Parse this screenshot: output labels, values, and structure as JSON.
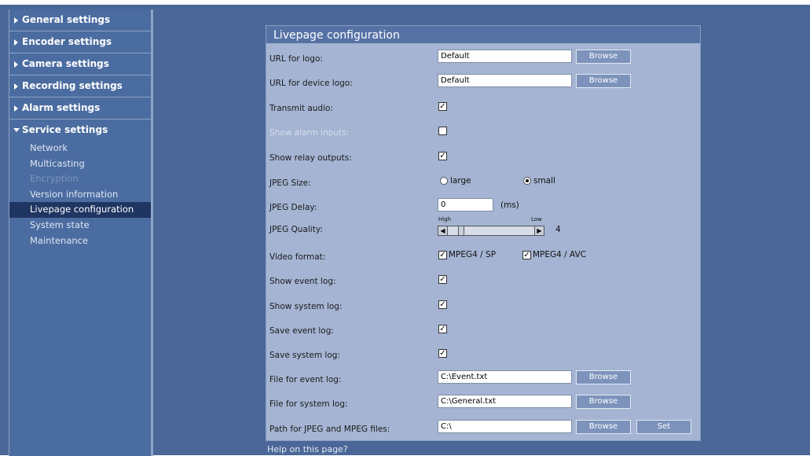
{
  "sidebar": {
    "sections": [
      {
        "label": "General settings"
      },
      {
        "label": "Encoder settings"
      },
      {
        "label": "Camera settings"
      },
      {
        "label": "Recording settings"
      },
      {
        "label": "Alarm settings"
      },
      {
        "label": "Service settings"
      }
    ],
    "service_items": [
      {
        "label": "Network"
      },
      {
        "label": "Multicasting"
      },
      {
        "label": "Encryption"
      },
      {
        "label": "Version information"
      },
      {
        "label": "Livepage configuration"
      },
      {
        "label": "System state"
      },
      {
        "label": "Maintenance"
      }
    ]
  },
  "panel": {
    "title": "Livepage configuration",
    "browse_label": "Browse",
    "set_label": "Set",
    "url_logo": {
      "label": "URL for logo:",
      "value": "Default"
    },
    "url_device_logo": {
      "label": "URL for device logo:",
      "value": "Default"
    },
    "transmit_audio": {
      "label": "Transmit audio:",
      "checked": true
    },
    "show_alarm_inputs": {
      "label": "Show alarm inputs:",
      "checked": false
    },
    "show_relay_outputs": {
      "label": "Show relay outputs:",
      "checked": true
    },
    "jpeg_size": {
      "label": "JPEG Size:",
      "options": [
        "large",
        "small"
      ],
      "selected": "small"
    },
    "jpeg_delay": {
      "label": "JPEG Delay:",
      "value": "0",
      "unit": "(ms)"
    },
    "jpeg_quality": {
      "label": "JPEG Quality:",
      "high": "High",
      "low": "Low",
      "value": "4"
    },
    "video_format": {
      "label": "Video format:",
      "options": [
        "MPEG4 / SP",
        "MPEG4 / AVC"
      ]
    },
    "show_event_log": {
      "label": "Show event log:",
      "checked": true
    },
    "show_system_log": {
      "label": "Show system log:",
      "checked": true
    },
    "save_event_log": {
      "label": "Save event log:",
      "checked": true
    },
    "save_system_log": {
      "label": "Save system log:",
      "checked": true
    },
    "event_log_file": {
      "label": "File for event log:",
      "value": "C:\\Event.txt"
    },
    "system_log_file": {
      "label": "File for system log:",
      "value": "C:\\General.txt"
    },
    "jpeg_mpeg_path": {
      "label": "Path for JPEG and MPEG files:",
      "value": "C:\\"
    }
  },
  "help_link": "Help on this page?",
  "check_mark": "✓"
}
